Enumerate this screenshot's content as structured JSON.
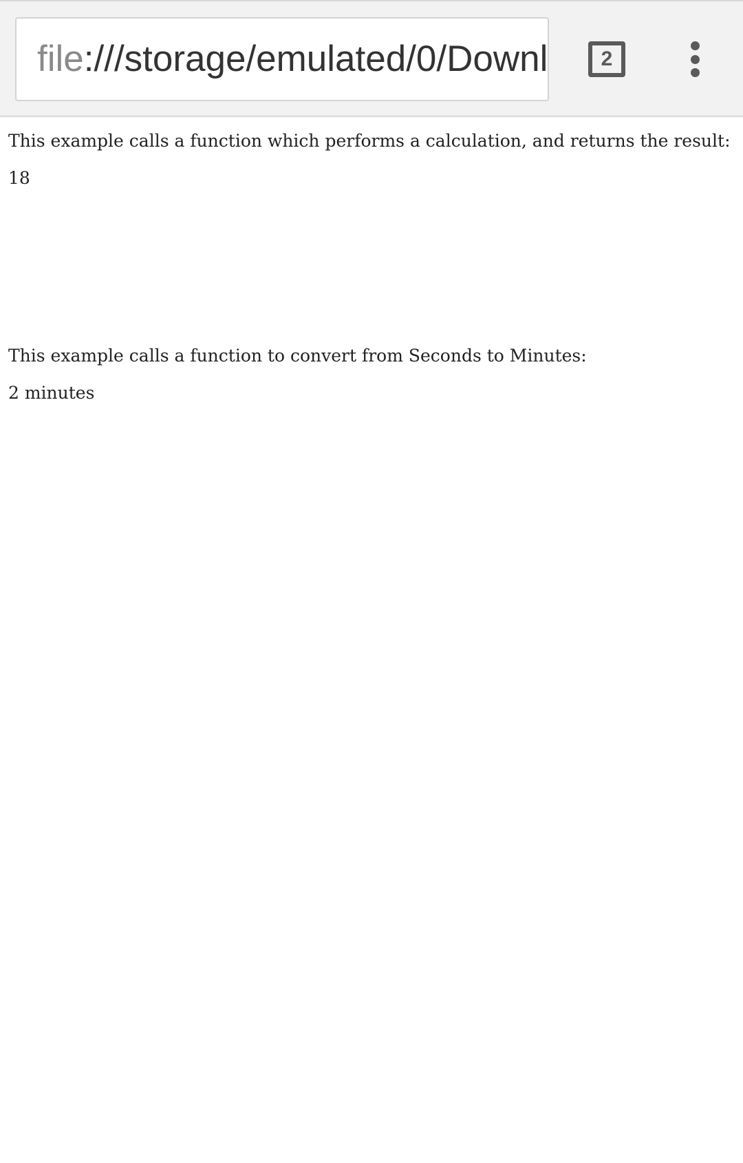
{
  "browser": {
    "url_scheme": "file",
    "url_rest": ":///storage/emulated/0/Downl",
    "tab_count": "2",
    "icons": {
      "tabs": "tab-switcher-icon",
      "menu": "overflow-menu-icon"
    }
  },
  "page": {
    "example1_text": "This example calls a function which performs a calculation, and returns the result:",
    "example1_result": "18",
    "example2_text": "This example calls a function to convert from Seconds to Minutes:",
    "example2_result": "2 minutes"
  }
}
